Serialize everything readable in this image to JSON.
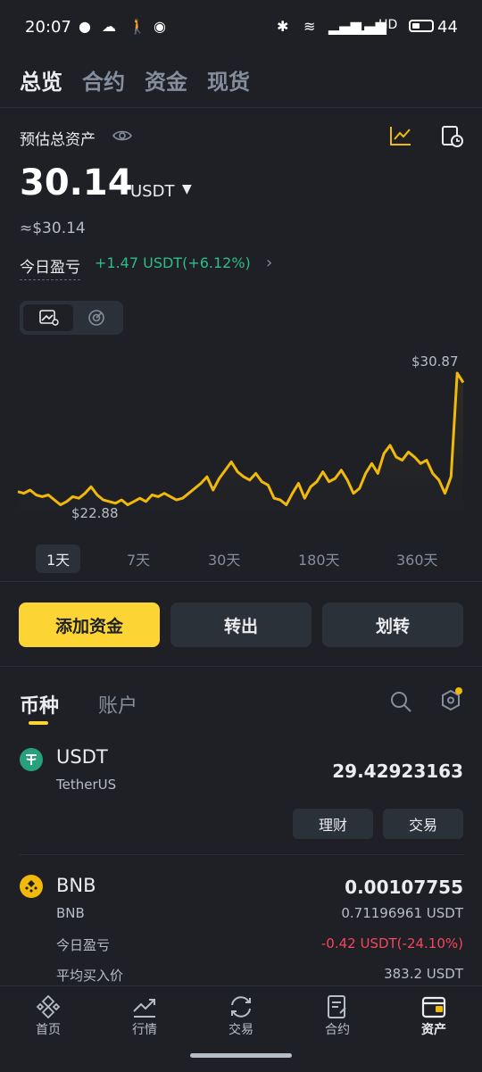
{
  "status_bar": {
    "time": "20:07",
    "battery": "44",
    "signal_text": "HD"
  },
  "top_tabs": [
    "总览",
    "合约",
    "资金",
    "现货"
  ],
  "overview": {
    "title": "预估总资产",
    "balance": "30.14",
    "currency": "USDT",
    "approx": "≈$30.14",
    "pnl_label": "今日盈亏",
    "pnl_value": "+1.47 USDT(+6.12%)"
  },
  "chart_data": {
    "type": "line",
    "high_label": "$30.87",
    "low_label": "$22.88",
    "high": 30.87,
    "low": 22.88,
    "values": [
      23.7,
      23.6,
      23.8,
      23.5,
      23.4,
      23.5,
      23.2,
      22.9,
      23.1,
      23.4,
      23.3,
      23.6,
      24.0,
      23.5,
      23.2,
      23.1,
      23.0,
      23.2,
      22.9,
      23.1,
      23.3,
      23.1,
      23.5,
      23.4,
      23.6,
      23.4,
      23.2,
      23.3,
      23.6,
      23.9,
      24.2,
      24.6,
      23.8,
      24.5,
      25.0,
      25.5,
      24.9,
      24.6,
      24.4,
      24.8,
      24.3,
      24.1,
      23.3,
      23.2,
      22.9,
      23.6,
      24.2,
      23.3,
      24.0,
      24.3,
      24.9,
      24.3,
      24.5,
      25.0,
      24.4,
      23.6,
      23.9,
      24.8,
      25.4,
      24.8,
      26.0,
      26.5,
      25.8,
      25.6,
      26.1,
      25.8,
      25.4,
      25.6,
      24.8,
      24.4,
      23.6,
      24.6,
      30.87,
      30.3
    ],
    "ranges": [
      "1天",
      "7天",
      "30天",
      "180天",
      "360天"
    ],
    "selected_range": "1天",
    "line_color": "#f0b90b"
  },
  "actions": {
    "deposit": "添加资金",
    "withdraw": "转出",
    "transfer": "划转"
  },
  "asset_tabs": [
    "币种",
    "账户"
  ],
  "assets": [
    {
      "symbol": "USDT",
      "name": "TetherUS",
      "amount": "29.42923163",
      "buttons": [
        "理财",
        "交易"
      ]
    },
    {
      "symbol": "BNB",
      "name": "BNB",
      "amount": "0.00107755",
      "value": "0.71196961 USDT",
      "pnl_label": "今日盈亏",
      "pnl_value": "-0.42 USDT(-24.10%)",
      "avg_label": "平均买入价",
      "avg_value": "383.2 USDT"
    }
  ],
  "bottom_nav": [
    {
      "label": "首页",
      "icon": "home-icon"
    },
    {
      "label": "行情",
      "icon": "markets-icon"
    },
    {
      "label": "交易",
      "icon": "trade-icon"
    },
    {
      "label": "合约",
      "icon": "futures-icon"
    },
    {
      "label": "资产",
      "icon": "wallet-icon",
      "active": true
    }
  ]
}
